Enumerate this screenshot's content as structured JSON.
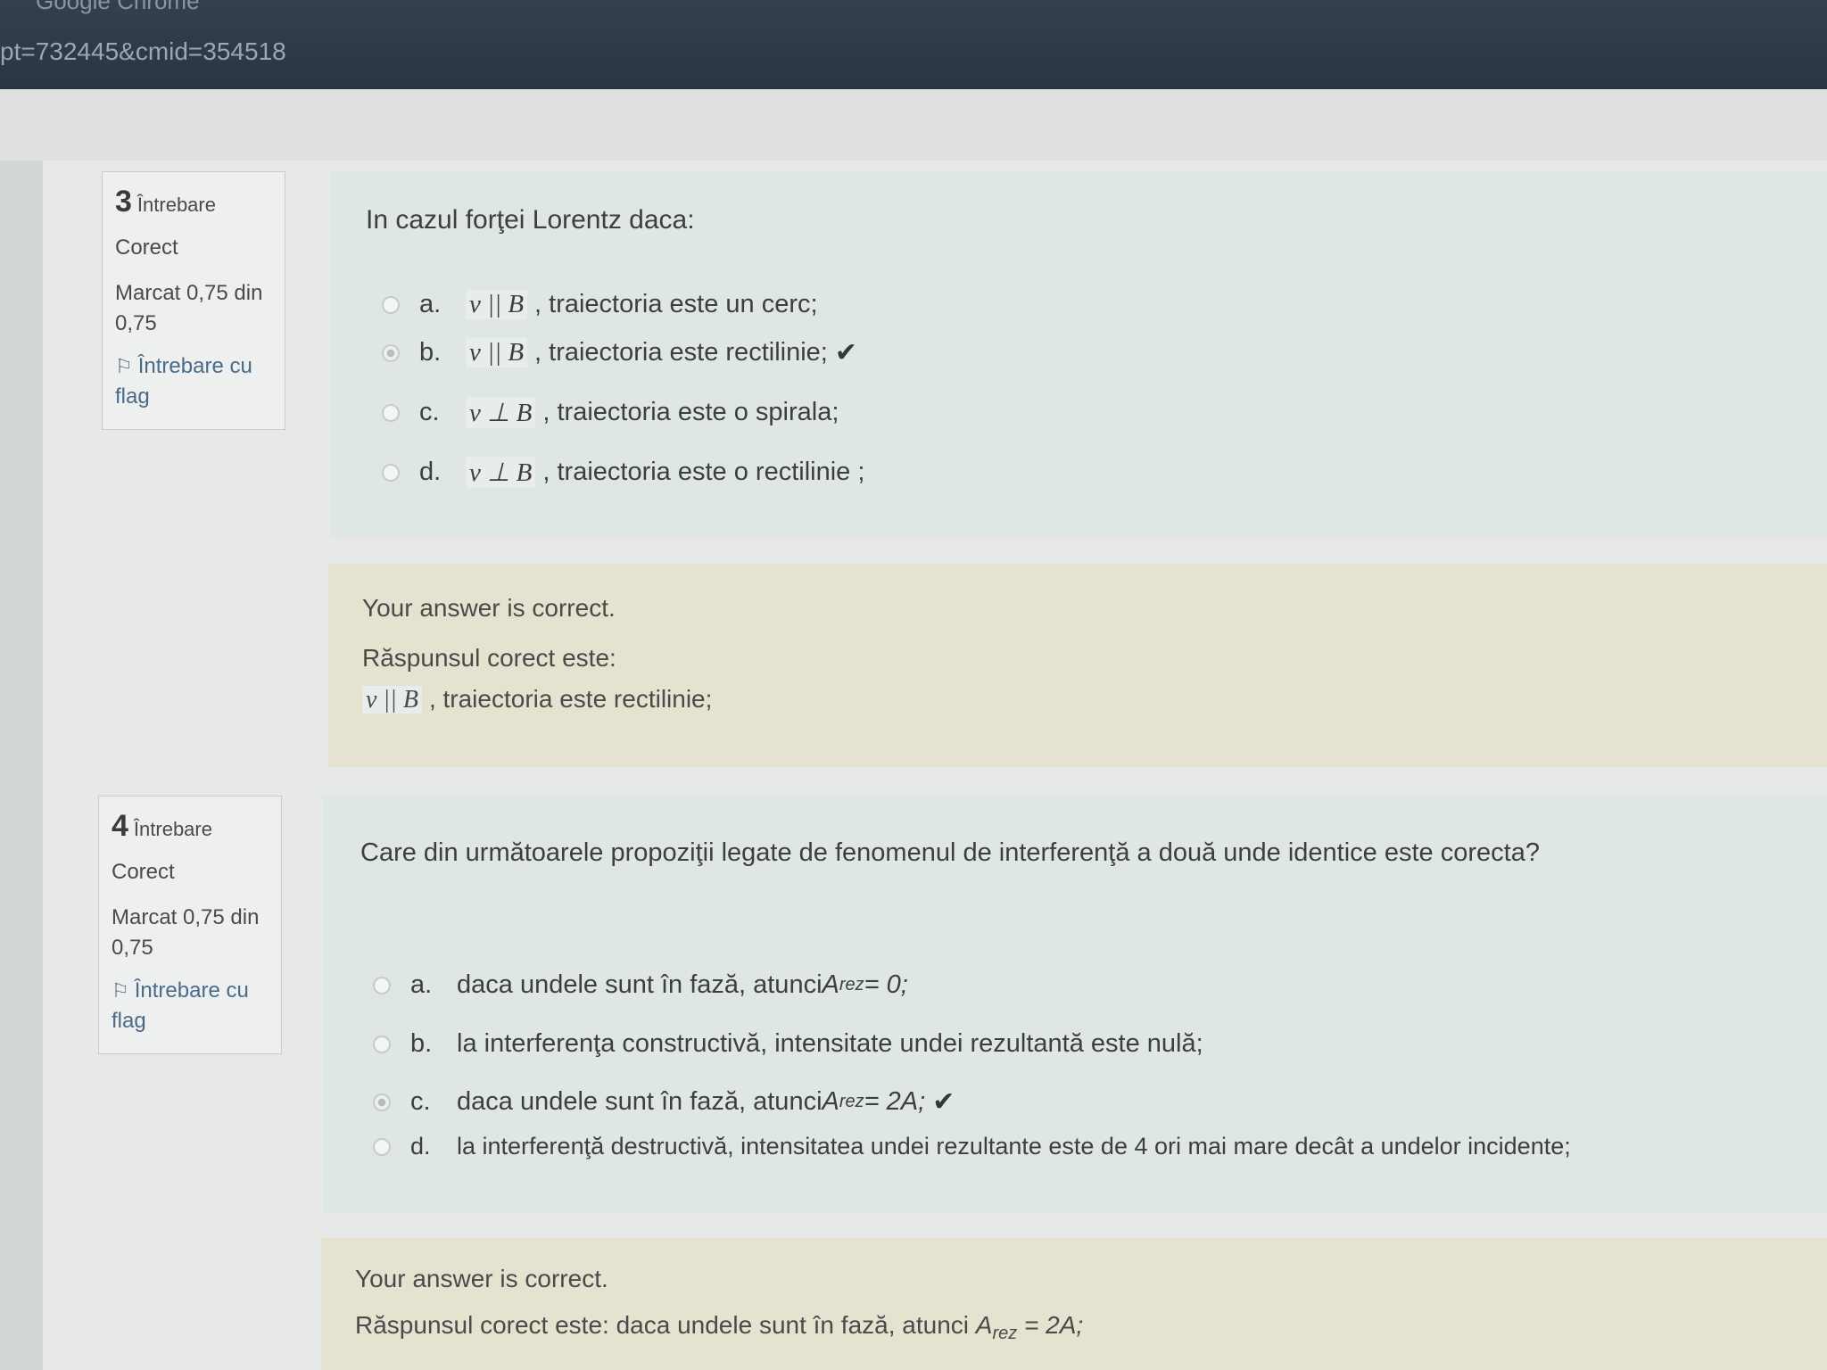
{
  "browser": {
    "title": "Google Chrome",
    "url": "pt=732445&cmid=354518"
  },
  "q3": {
    "number": "3",
    "word": "Întrebare",
    "status": "Corect",
    "grade_line1": "Marcat 0,75 din",
    "grade_line2": "0,75",
    "flag_line1": "Întrebare cu",
    "flag_line2": "flag",
    "question": "In cazul forţei Lorentz daca:",
    "options": [
      {
        "letter": "a.",
        "math": "v || B",
        "text": ", traiectoria este un cerc;",
        "selected": false,
        "correct": false
      },
      {
        "letter": "b.",
        "math": "v || B",
        "text": ", traiectoria este rectilinie;",
        "selected": true,
        "correct": true
      },
      {
        "letter": "c.",
        "math": "v ⊥ B",
        "text": ", traiectoria este o spirala;",
        "selected": false,
        "correct": false
      },
      {
        "letter": "d.",
        "math": "v ⊥ B",
        "text": ", traiectoria este o rectilinie ;",
        "selected": false,
        "correct": false
      }
    ],
    "feedback": "Your answer is correct.",
    "correct_label": "Răspunsul corect este:",
    "correct_math": "v || B",
    "correct_text": ", traiectoria este rectilinie;"
  },
  "q4": {
    "number": "4",
    "word": "Întrebare",
    "status": "Corect",
    "grade_line1": "Marcat 0,75 din",
    "grade_line2": "0,75",
    "flag_line1": "Întrebare cu",
    "flag_line2": "flag",
    "question": "Care din următoarele propoziţii legate de fenomenul de interferenţă a două unde identice este corecta?",
    "options": [
      {
        "letter": "a.",
        "pre": "daca undele sunt în fază, atunci ",
        "var": "A",
        "sub": "rez",
        "post": " = 0;",
        "selected": false,
        "correct": false
      },
      {
        "letter": "b.",
        "pre": "la interferenţa constructivă, intensitate undei rezultantă este nulă;",
        "var": "",
        "sub": "",
        "post": "",
        "selected": false,
        "correct": false
      },
      {
        "letter": "c.",
        "pre": "daca undele sunt în fază, atunci ",
        "var": "A",
        "sub": "rez",
        "post": " = 2A;",
        "selected": true,
        "correct": true
      },
      {
        "letter": "d.",
        "pre": "la interferenţă destructivă, intensitatea undei rezultante este de 4 ori mai mare decât a undelor incidente;",
        "var": "",
        "sub": "",
        "post": "",
        "selected": false,
        "correct": false
      }
    ],
    "feedback": "Your answer is correct.",
    "correct_pre": "Răspunsul corect este: daca undele sunt în fază, atunci ",
    "correct_var": "A",
    "correct_sub": "rez",
    "correct_post": " = 2A;"
  }
}
